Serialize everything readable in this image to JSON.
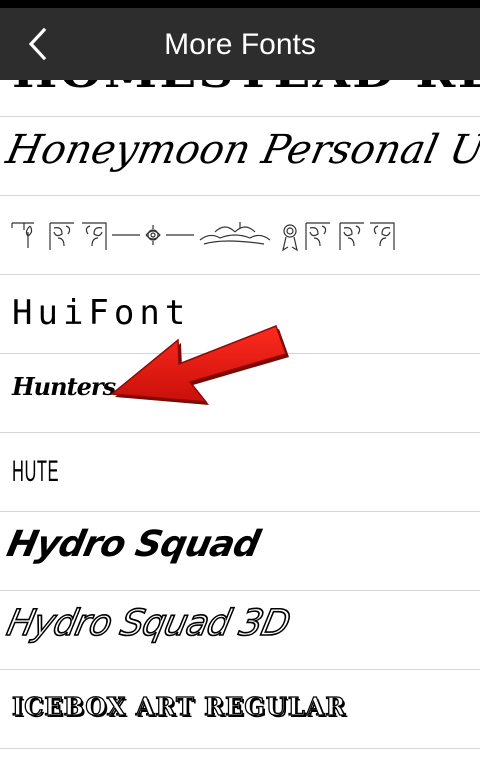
{
  "app_bar": {
    "title": "More Fonts",
    "back_icon": "chevron-left-icon"
  },
  "fonts": [
    {
      "name": "HOMESTEAD REGULAR"
    },
    {
      "name": "Honeymoon Personal Use"
    },
    {
      "name": "",
      "ornamental": true,
      "icon": "ornament-dingbats-icon"
    },
    {
      "name": "HuiFont"
    },
    {
      "name": "Hunters"
    },
    {
      "name": "HUTE"
    },
    {
      "name": "Hydro Squad"
    },
    {
      "name": "Hydro Squad 3D"
    },
    {
      "name": "ICEBOX ART REGULAR"
    }
  ],
  "annotation": {
    "icon": "red-arrow-icon",
    "color": "#e8120c"
  },
  "colors": {
    "app_bar": "#2d2d2d",
    "status_bar": "#000000",
    "divider": "#d6d6d6"
  }
}
